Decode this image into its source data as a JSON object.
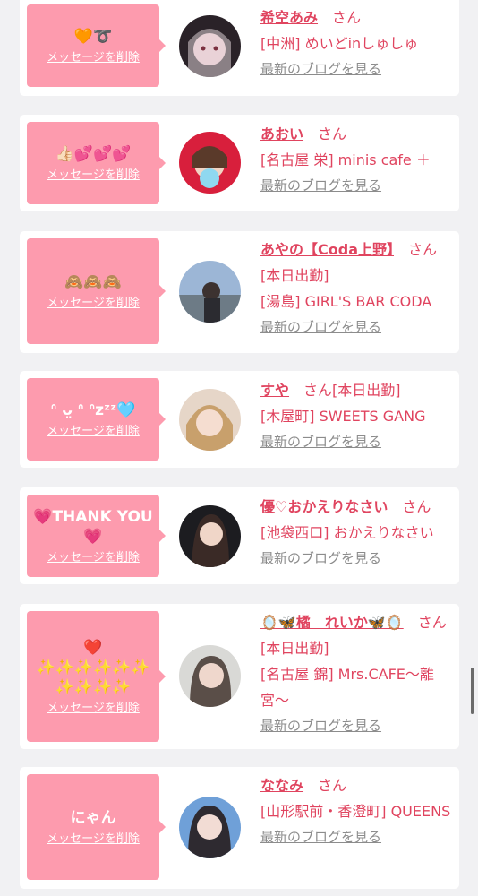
{
  "delete_label": "メッセージを削除",
  "blog_label": "最新のブログを見る",
  "san_label": "さん",
  "colors": {
    "accent": "#e0445f",
    "bubble": "#fd9bae",
    "link_gray": "#8c8c8c"
  },
  "cards": [
    {
      "message": "🧡➰",
      "name": "希空あみ",
      "status": "",
      "shop": "[中洲] めいどinしゅしゅ"
    },
    {
      "message": "👍🏻💕💕💕",
      "name": "あおい",
      "status": "",
      "shop": "[名古屋 栄] minis cafe ＋"
    },
    {
      "message": "🙈🙈🙈",
      "name": "あやの【Coda上野】",
      "status": "[本日出勤]",
      "shop": "[湯島] GIRL'S BAR CODA"
    },
    {
      "message": "ᐢ ᴗ̤ ᐢ ᐢzᶻᶻ🩵",
      "name": "すや",
      "status": "[本日出勤]",
      "shop": "[木屋町] SWEETS GANG"
    },
    {
      "message": "💗THANK YOU💗",
      "name": "優♡おかえりなさい",
      "status": "",
      "shop": "[池袋西口] おかえりなさい"
    },
    {
      "message": "❤️\n✨✨✨✨✨✨\n✨✨✨✨",
      "name": "🪞🦋橘　れいか🦋🪞",
      "status": "[本日出勤]",
      "shop": "[名古屋 錦] Mrs.CAFE〜離宮〜"
    },
    {
      "message": "にゃん",
      "name": "ななみ",
      "status": "",
      "shop": "[山形駅前・香澄町] QUEENS"
    }
  ]
}
